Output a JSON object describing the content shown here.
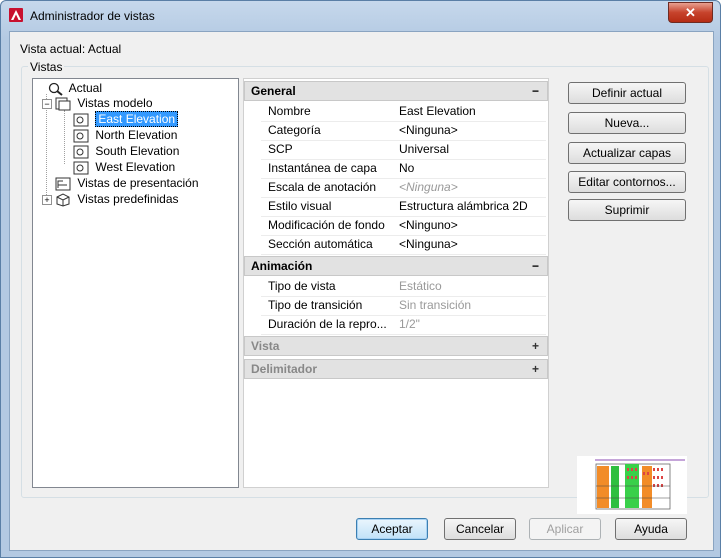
{
  "window": {
    "title": "Administrador de vistas",
    "close_glyph": "✕"
  },
  "current_view": "Vista actual: Actual",
  "group_label": "Vistas",
  "tree": {
    "actual": "Actual",
    "model_views": "Vistas modelo",
    "model_children": [
      "East Elevation",
      "North Elevation",
      "South Elevation",
      "West Elevation"
    ],
    "layout_views": "Vistas de presentación",
    "preset_views": "Vistas predefinidas",
    "selected": "East Elevation"
  },
  "properties": {
    "general": {
      "label": "General",
      "toggle": "−",
      "rows": [
        {
          "name": "Nombre",
          "value": "East Elevation"
        },
        {
          "name": "Categoría",
          "value": "<Ninguna>"
        },
        {
          "name": "SCP",
          "value": "Universal"
        },
        {
          "name": "Instantánea de capa",
          "value": "No"
        },
        {
          "name": "Escala de anotación",
          "value": "<Ninguna>"
        },
        {
          "name": "Estilo visual",
          "value": "Estructura alámbrica 2D"
        },
        {
          "name": "Modificación de fondo",
          "value": "<Ninguno>"
        },
        {
          "name": "Sección automática",
          "value": "<Ninguna>"
        }
      ]
    },
    "animation": {
      "label": "Animación",
      "toggle": "−",
      "rows": [
        {
          "name": "Tipo de vista",
          "value": "Estático"
        },
        {
          "name": "Tipo de transición",
          "value": "Sin transición"
        },
        {
          "name": "Duración  de la  repro...",
          "value": "1/2\""
        }
      ]
    },
    "view": {
      "label": "Vista",
      "toggle": "+"
    },
    "boundary": {
      "label": "Delimitador",
      "toggle": "+"
    }
  },
  "buttons": {
    "set_current": "Definir actual",
    "new": "Nueva...",
    "update_layers": "Actualizar capas",
    "edit_boundaries": "Editar contornos...",
    "delete": "Suprimir",
    "ok": "Aceptar",
    "cancel": "Cancelar",
    "apply": "Aplicar",
    "help": "Ayuda"
  }
}
